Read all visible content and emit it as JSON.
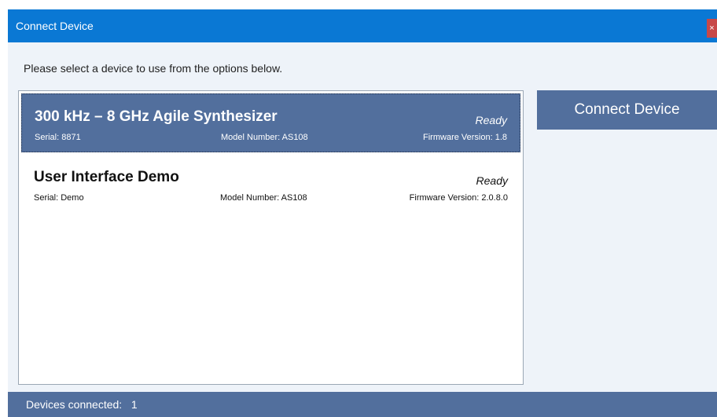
{
  "window": {
    "title": "Connect Device",
    "close_glyph": "×"
  },
  "instruction": "Please select a device to use from the options below.",
  "devices": [
    {
      "name": "300 kHz – 8 GHz Agile Synthesizer",
      "status": "Ready",
      "serial": "Serial: 8871",
      "model": "Model Number: AS108",
      "firmware": "Firmware Version: 1.8",
      "selected": true
    },
    {
      "name": "User Interface Demo",
      "status": "Ready",
      "serial": "Serial: Demo",
      "model": "Model Number: AS108",
      "firmware": "Firmware Version: 2.0.8.0",
      "selected": false
    }
  ],
  "connect_button_label": "Connect Device",
  "status_bar": {
    "label": "Devices connected:",
    "count": "1"
  },
  "colors": {
    "titlebar": "#0a78d4",
    "selected_row": "#526f9d",
    "button": "#526f9d",
    "status_bar": "#526f9d",
    "close_button": "#c74848"
  }
}
